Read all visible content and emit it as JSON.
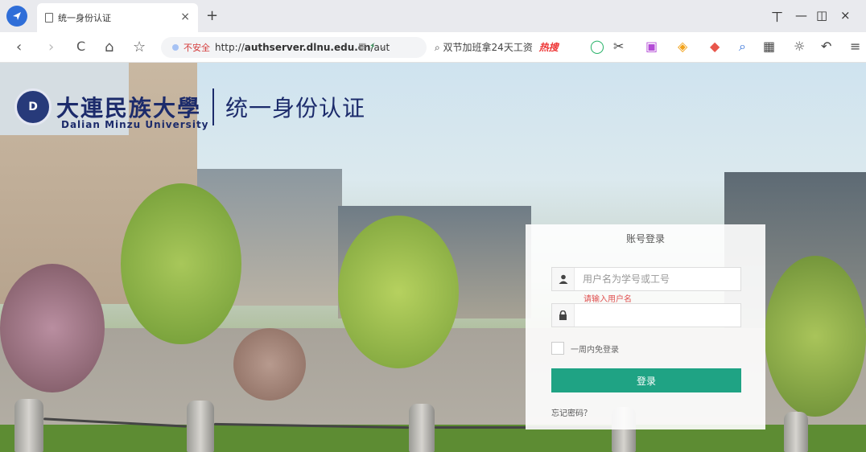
{
  "browser": {
    "tab_title": "统一身份认证",
    "tab_close": "×",
    "new_tab": "+",
    "window_controls": [
      "ㄒ",
      "—",
      "◫",
      "×"
    ],
    "nav_buttons": [
      "‹",
      "›",
      "C",
      "⌂",
      "☆"
    ],
    "url_insecure_badge": "不安全",
    "url_prefix": "http://",
    "url_host": "authserver.dlnu.edu.cn",
    "url_path": "/aut",
    "search_text": "双节加班拿24天工资",
    "search_hot_badge": "热搜"
  },
  "header": {
    "school_name_cn": "大連民族大學",
    "school_name_en": "Dalian Minzu University",
    "system_title": "统一身份认证"
  },
  "login": {
    "title": "账号登录",
    "username_placeholder": "用户名为学号或工号",
    "username_error": "请输入用户名",
    "password_placeholder": "",
    "remember_label": "一周内免登录",
    "submit_label": "登录",
    "forgot_label": "忘记密码？"
  },
  "colors": {
    "accent_button": "#1fa384",
    "error_text": "#e05252",
    "brand_navy": "#1c2b6b"
  }
}
